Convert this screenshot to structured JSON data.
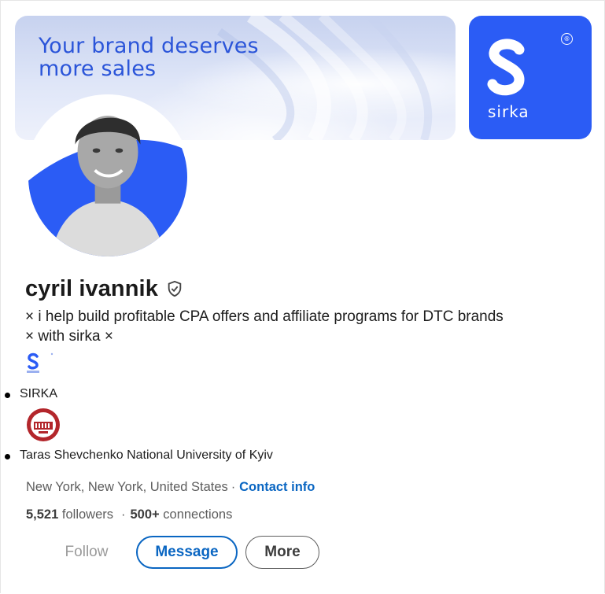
{
  "banner": {
    "headline": "Your brand deserves more sales",
    "brand_word": "sirka",
    "registered_mark": "®"
  },
  "profile": {
    "name": "cyril ivannik",
    "headline_line1": "× i help build profitable CPA offers and affiliate programs for DTC brands",
    "headline_line2": "× with sirka ×",
    "location": "New York, New York, United States",
    "location_separator": "·",
    "contact_link": "Contact info"
  },
  "experience": [
    {
      "label": "SIRKA"
    },
    {
      "label": "Taras Shevchenko National University of Kyiv"
    }
  ],
  "stats": {
    "followers_count": "5,521",
    "followers_label": "followers",
    "separator": "·",
    "connections_count": "500+",
    "connections_label": "connections"
  },
  "actions": {
    "follow": "Follow",
    "message": "Message",
    "more": "More"
  },
  "colors": {
    "brand_blue": "#2b5cf5",
    "link_blue": "#0a66c2",
    "muted_text": "#5d5d5d"
  }
}
